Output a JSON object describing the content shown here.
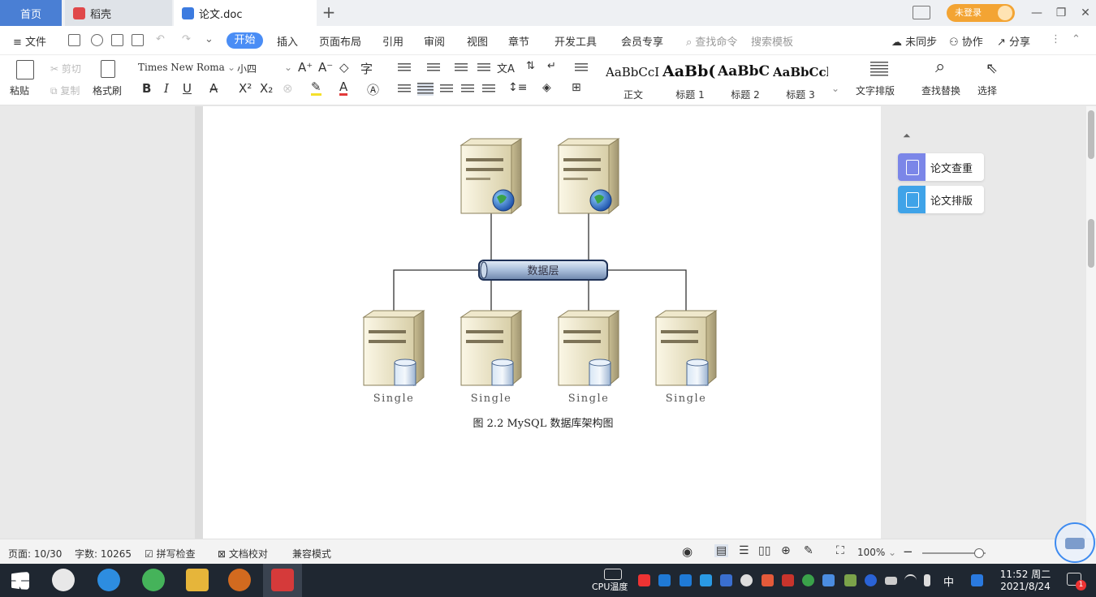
{
  "tabs": [
    {
      "label": "首页"
    },
    {
      "label": "稻壳"
    },
    {
      "label": "论文.doc"
    }
  ],
  "titlebar": {
    "login_label": "未登录"
  },
  "menu": {
    "file": "文件",
    "start": "开始",
    "items": [
      "插入",
      "页面布局",
      "引用",
      "审阅",
      "视图",
      "章节",
      "开发工具",
      "会员专享"
    ],
    "search_cmd": "查找命令",
    "search_template": "搜索模板",
    "unsync": "未同步",
    "collab": "协作",
    "share": "分享"
  },
  "ribbon": {
    "paste": "粘贴",
    "cut": "剪切",
    "copy": "复制",
    "format_painter": "格式刷",
    "font_name": "Times New Roma",
    "font_size": "小四",
    "styles": [
      {
        "sample": "AaBbCcI",
        "name": "正文"
      },
      {
        "sample": "AaBb(",
        "name": "标题 1"
      },
      {
        "sample": "AaBbC",
        "name": "标题 2"
      },
      {
        "sample": "AaBbCcl",
        "name": "标题 3"
      }
    ],
    "text_layout": "文字排版",
    "find_replace": "查找替换",
    "select": "选择"
  },
  "diagram": {
    "bus_label": "数据层",
    "node_labels": [
      "Single",
      "Single",
      "Single",
      "Single"
    ],
    "caption": "图 2.2 MySQL 数据库架构图"
  },
  "side_panel": {
    "items": [
      {
        "label": "论文查重",
        "color": "#7b86e8"
      },
      {
        "label": "论文排版",
        "color": "#3fa3e8"
      }
    ]
  },
  "status": {
    "page": "页面: 10/30",
    "words": "字数: 10265",
    "spell": "拼写检查",
    "proof": "文档校对",
    "compat": "兼容模式",
    "zoom": "100%",
    "zoom_level": 0.9
  },
  "taskbar": {
    "cpu": "CPU温度",
    "ime": "中",
    "time": "11:52 周二",
    "date": "2021/8/24",
    "notify_count": "1"
  },
  "colors": {
    "accent": "#4a8df5",
    "home_tab": "#4a7fd4",
    "login": "#f3a433"
  }
}
